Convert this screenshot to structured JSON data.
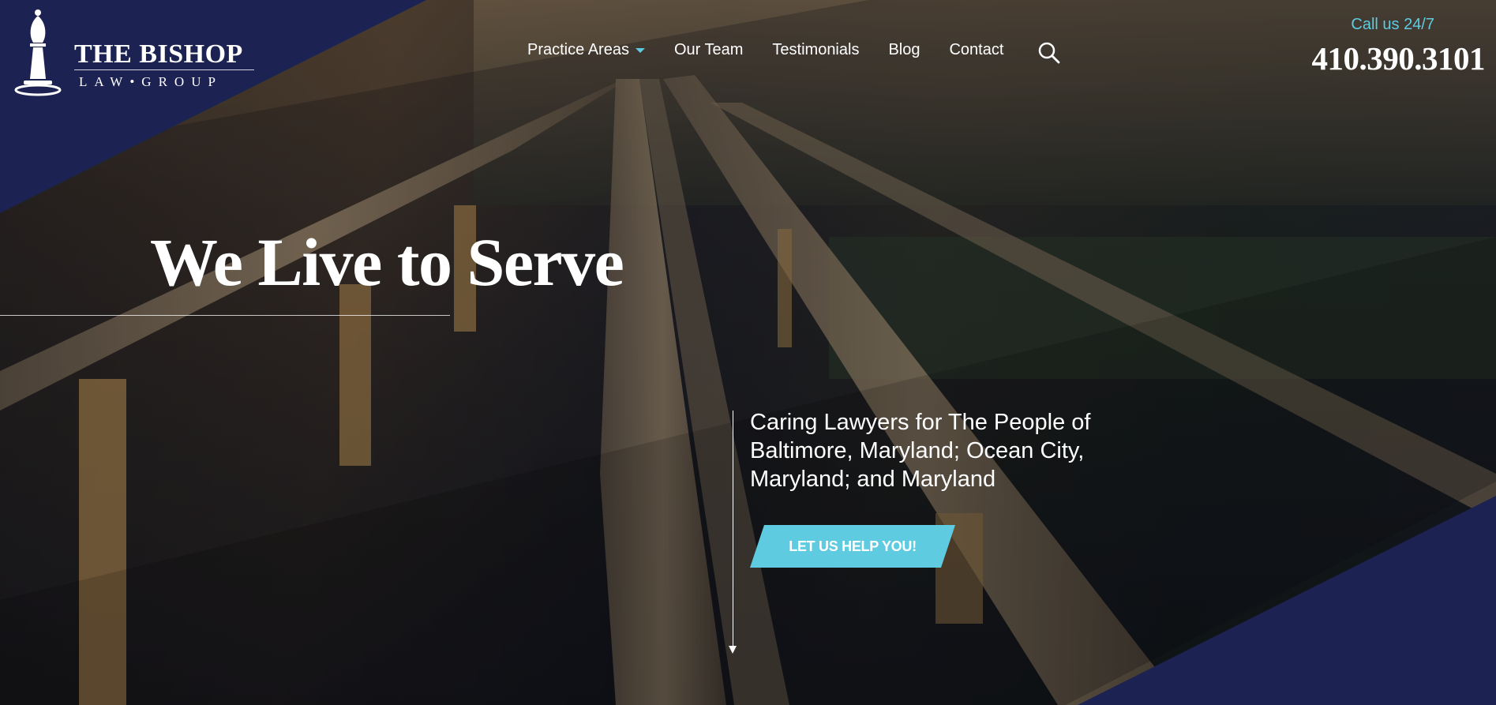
{
  "brand": {
    "name": "THE BISHOP",
    "subname": "LAW•GROUP",
    "icon": "bishop-chess-piece-icon",
    "colors": {
      "navy": "#1c2353",
      "accent": "#5ecbe0",
      "text": "#ffffff"
    }
  },
  "nav": {
    "items": [
      {
        "label": "Practice Areas",
        "has_dropdown": true
      },
      {
        "label": "Our Team"
      },
      {
        "label": "Testimonials"
      },
      {
        "label": "Blog"
      },
      {
        "label": "Contact"
      }
    ],
    "search_icon": "search-icon"
  },
  "contact": {
    "call_label": "Call us 24/7",
    "phone": "410.390.3101"
  },
  "hero": {
    "headline": "We Live to Serve",
    "tagline": "Caring Lawyers for The People of Baltimore, Maryland; Ocean City, Maryland; and Maryland",
    "cta_label": "LET US HELP YOU!"
  }
}
